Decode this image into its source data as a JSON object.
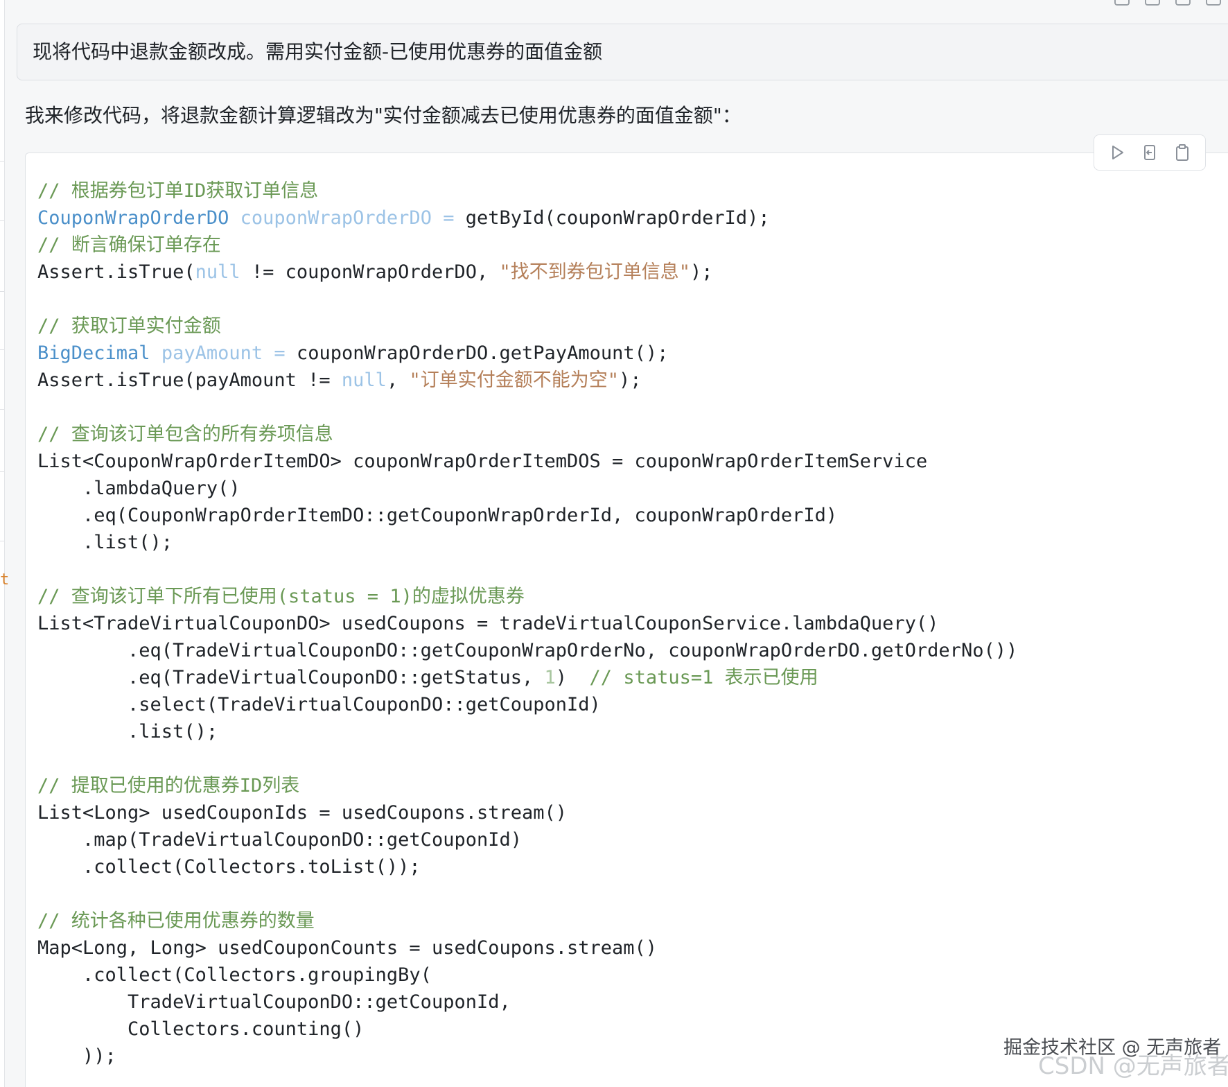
{
  "user_message": "现将代码中退款金额改成。需用实付金额-已使用优惠券的面值金额",
  "assistant_reply": "我来修改代码，将退款金额计算逻辑改为\"实付金额减去已使用优惠券的面值金额\"：",
  "code_toolbar": {
    "icons": [
      "run-icon",
      "insert-icon",
      "copy-icon"
    ]
  },
  "code": {
    "l1": "// 根据券包订单ID获取订单信息",
    "l2_type": "CouponWrapOrderDO",
    "l2_var": "couponWrapOrderDO",
    "l2_eq": "=",
    "l2_rest": "getById(couponWrapOrderId);",
    "l3": "// 断言确保订单存在",
    "l4_a": "Assert.isTrue(",
    "l4_null": "null",
    "l4_b": " != couponWrapOrderDO, ",
    "l4_str": "\"找不到券包订单信息\"",
    "l4_c": ");",
    "l6": "// 获取订单实付金额",
    "l7_type": "BigDecimal",
    "l7_var": "payAmount",
    "l7_eq": "=",
    "l7_rest": "couponWrapOrderDO.getPayAmount();",
    "l8_a": "Assert.isTrue(payAmount != ",
    "l8_null": "null",
    "l8_b": ", ",
    "l8_str": "\"订单实付金额不能为空\"",
    "l8_c": ");",
    "l10": "// 查询该订单包含的所有券项信息",
    "l11": "List<CouponWrapOrderItemDO> couponWrapOrderItemDOS = couponWrapOrderItemService",
    "l12": "    .lambdaQuery()",
    "l13": "    .eq(CouponWrapOrderItemDO::getCouponWrapOrderId, couponWrapOrderId)",
    "l14": "    .list();",
    "l16": "// 查询该订单下所有已使用(status = 1)的虚拟优惠券",
    "l17": "List<TradeVirtualCouponDO> usedCoupons = tradeVirtualCouponService.lambdaQuery()",
    "l18": "        .eq(TradeVirtualCouponDO::getCouponWrapOrderNo, couponWrapOrderDO.getOrderNo())",
    "l19_a": "        .eq(TradeVirtualCouponDO::getStatus, ",
    "l19_num": "1",
    "l19_b": ")  ",
    "l19_cm": "// status=1 表示已使用",
    "l20": "        .select(TradeVirtualCouponDO::getCouponId)",
    "l21": "        .list();",
    "l23": "// 提取已使用的优惠券ID列表",
    "l24": "List<Long> usedCouponIds = usedCoupons.stream()",
    "l25": "    .map(TradeVirtualCouponDO::getCouponId)",
    "l26": "    .collect(Collectors.toList());",
    "l28": "// 统计各种已使用优惠券的数量",
    "l29": "Map<Long, Long> usedCouponCounts = usedCoupons.stream()",
    "l30": "    .collect(Collectors.groupingBy(",
    "l31": "        TradeVirtualCouponDO::getCouponId,",
    "l32": "        Collectors.counting()",
    "l33": "    ));"
  },
  "watermark": {
    "line1": "掘金技术社区 @ 无声旅者",
    "line2": "CSDN @无声旅者"
  },
  "colors": {
    "comment": "#6a9955",
    "type": "#4a8fc9",
    "variable": "#9cc3e6",
    "string": "#b5805a",
    "number": "#a8c69f"
  }
}
